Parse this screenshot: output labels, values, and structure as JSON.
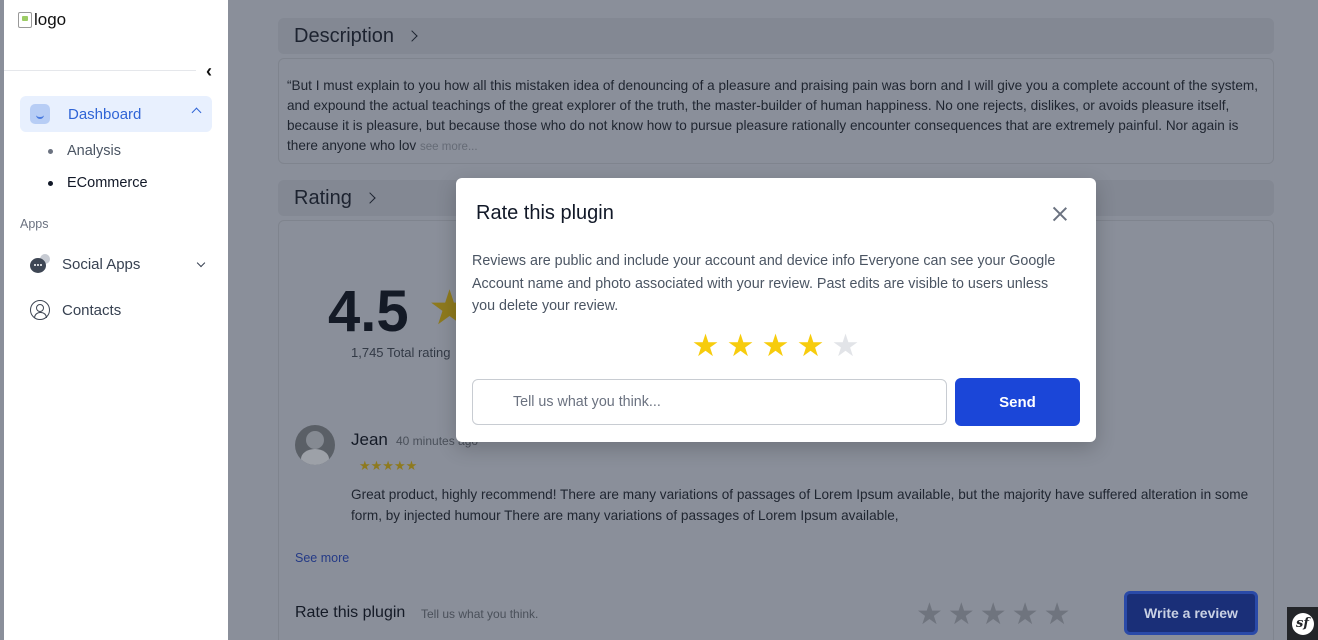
{
  "sidebar": {
    "logo_alt": "logo",
    "items": [
      {
        "label": "Dashboard"
      },
      {
        "label": "Analysis"
      },
      {
        "label": "ECommerce"
      }
    ],
    "section_apps": "Apps",
    "apps": [
      {
        "label": "Social Apps"
      },
      {
        "label": "Contacts"
      }
    ]
  },
  "main": {
    "description_title": "Description",
    "description_text": "“But I must explain to you how all this mistaken idea of denouncing of a pleasure and praising pain was born and I will give you a complete account of the system, and expound the actual teachings of the great explorer of the truth, the master-builder of human happiness. No one rejects, dislikes, or avoids pleasure itself, because it is pleasure, but because those who do not know how to pursue pleasure rationally encounter consequences that are extremely painful. Nor again is there anyone who lov",
    "description_see_more": "see more...",
    "rating_title": "Rating",
    "rating_value": "4.5",
    "total_ratings": "1,745 Total rating",
    "review": {
      "name": "Jean",
      "time": "40 minutes ago",
      "stars": "★★★★★",
      "text": "Great product, highly recommend! There are many variations of passages of Lorem Ipsum available, but the majority have suffered alteration in some form, by injected humour There are many variations of passages of Lorem Ipsum available,"
    },
    "see_more": "See more",
    "rate_plugin_title": "Rate this plugin",
    "rate_plugin_sub": "Tell us what you think.",
    "footer_stars": "★★★★★",
    "write_review_label": "Write a review"
  },
  "modal": {
    "title": "Rate this plugin",
    "description": "Reviews are public and include your account and device info Everyone can see your Google Account name and photo associated with your review. Past edits are visible to users unless you delete your review.",
    "rating": 4,
    "max_rating": 5,
    "input_placeholder": "Tell us what you think...",
    "send_label": "Send"
  },
  "badge": "sf",
  "colors": {
    "accent": "#1b46d8",
    "star_active": "#f7cc0d",
    "star_inactive": "#e2e4e8",
    "overlay": "#8a8f9a"
  }
}
